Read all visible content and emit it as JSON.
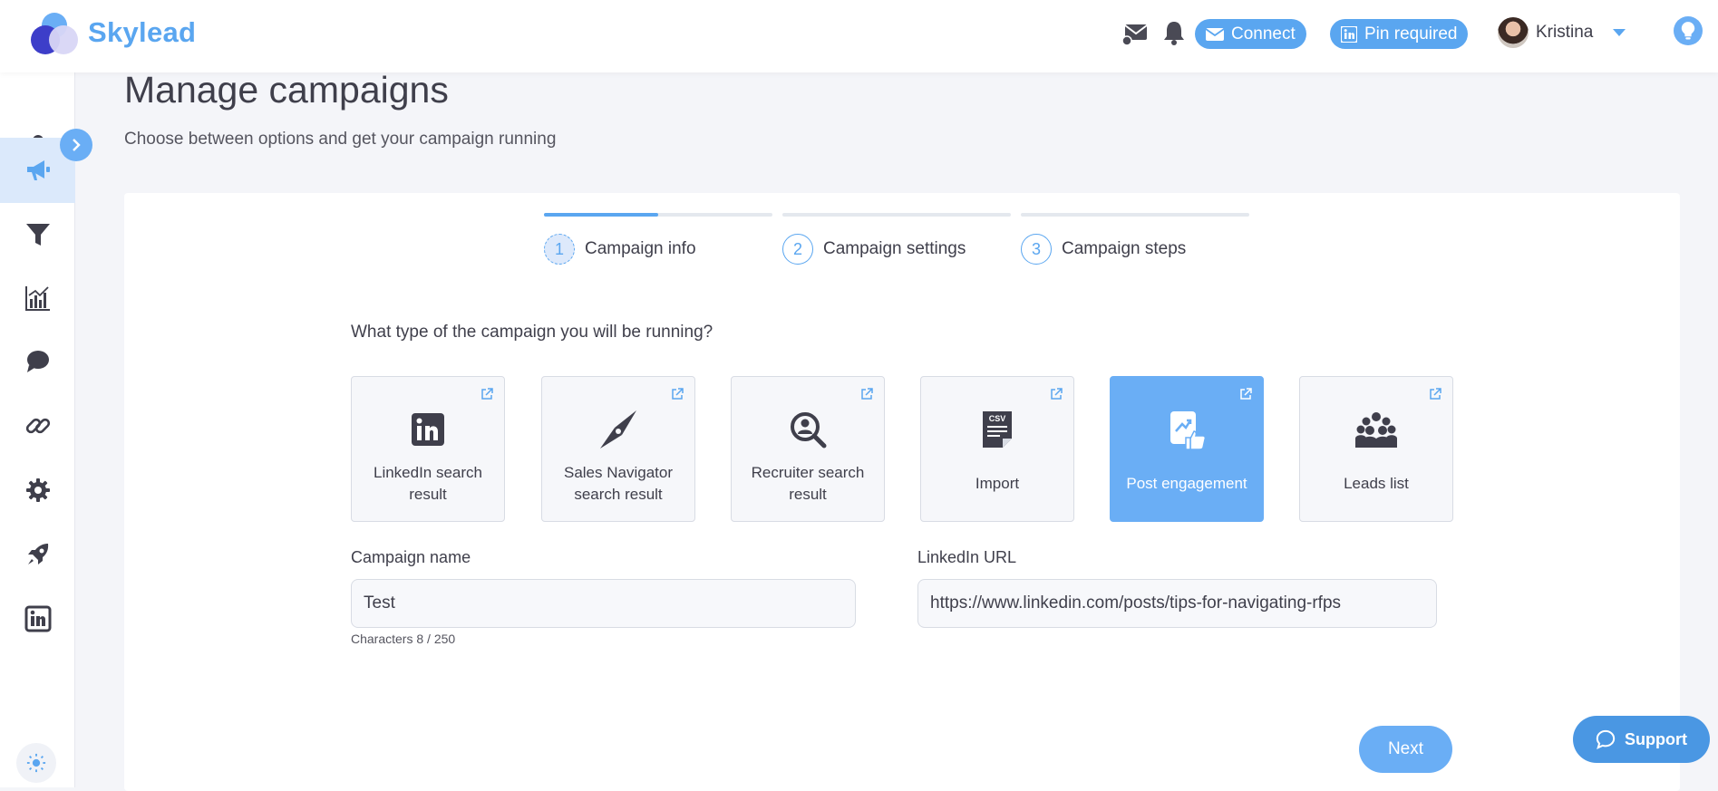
{
  "header": {
    "brand": "Skylead",
    "connect_label": "Connect",
    "pin_label": "Pin required",
    "user_name": "Kristina"
  },
  "sidebar": {
    "items": [
      {
        "icon": "user-icon",
        "active": false
      },
      {
        "icon": "megaphone-icon",
        "active": true
      },
      {
        "icon": "filter-icon",
        "active": false
      },
      {
        "icon": "chart-icon",
        "active": false
      },
      {
        "icon": "chat-icon",
        "active": false
      },
      {
        "icon": "link-icon",
        "active": false
      },
      {
        "icon": "gear-icon",
        "active": false
      },
      {
        "icon": "rocket-icon",
        "active": false
      },
      {
        "icon": "linkedin-icon",
        "active": false
      }
    ]
  },
  "page": {
    "title": "Manage campaigns",
    "subtitle": "Choose between options and get your campaign running"
  },
  "steps": [
    {
      "num": "1",
      "label": "Campaign info",
      "progress": 0.5
    },
    {
      "num": "2",
      "label": "Campaign settings",
      "progress": 0
    },
    {
      "num": "3",
      "label": "Campaign steps",
      "progress": 0
    }
  ],
  "form": {
    "question": "What type of the campaign you will be running?",
    "types": [
      {
        "label": "LinkedIn search result",
        "icon": "linkedin-icon",
        "selected": false
      },
      {
        "label": "Sales Navigator search result",
        "icon": "compass-icon",
        "selected": false
      },
      {
        "label": "Recruiter search result",
        "icon": "recruiter-search-icon",
        "selected": false
      },
      {
        "label": "Import",
        "icon": "csv-icon",
        "selected": false
      },
      {
        "label": "Post engagement",
        "icon": "post-engagement-icon",
        "selected": true
      },
      {
        "label": "Leads list",
        "icon": "leads-list-icon",
        "selected": false
      }
    ],
    "campaign_name_label": "Campaign name",
    "campaign_name_value": "Test",
    "char_count": "Characters 8 / 250",
    "linkedin_url_label": "LinkedIn URL",
    "linkedin_url_value": "https://www.linkedin.com/posts/tips-for-navigating-rfps"
  },
  "buttons": {
    "next": "Next",
    "support": "Support"
  },
  "colors": {
    "accent": "#5aa6f0",
    "icon_dark": "#3f3f4b",
    "selected_card": "#6aaef5"
  }
}
